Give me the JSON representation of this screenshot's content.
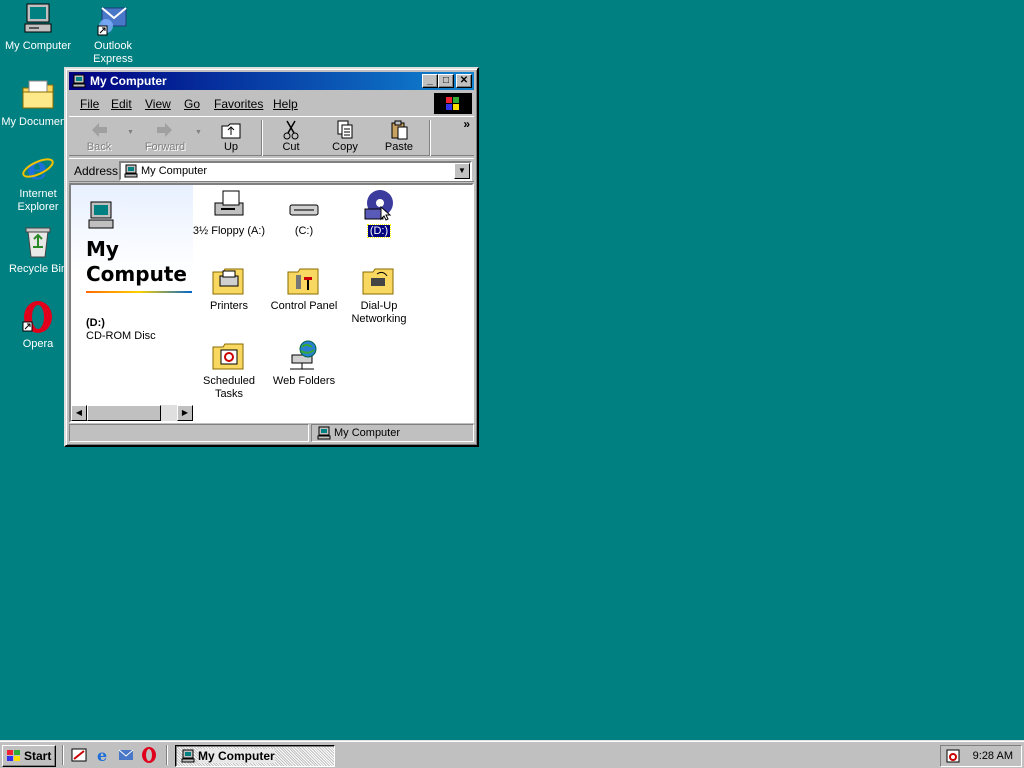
{
  "desktop": {
    "icons": [
      {
        "label": "My Computer"
      },
      {
        "label": "Outlook Express"
      },
      {
        "label": "My Documents"
      },
      {
        "label": "Internet Explorer"
      },
      {
        "label": "Recycle Bin"
      },
      {
        "label": "Opera"
      }
    ],
    "background_color": "#008080"
  },
  "window": {
    "title": "My Computer",
    "menu": [
      "File",
      "Edit",
      "View",
      "Go",
      "Favorites",
      "Help"
    ],
    "toolbar": {
      "back": "Back",
      "forward": "Forward",
      "up": "Up",
      "cut": "Cut",
      "copy": "Copy",
      "paste": "Paste",
      "more": "»"
    },
    "address": {
      "label": "Address",
      "value": "My Computer"
    },
    "sidebar": {
      "title_line1": "My",
      "title_line2": "Compute",
      "selected_name": "(D:)",
      "selected_type": "CD-ROM Disc"
    },
    "items": [
      {
        "label": "3½ Floppy (A:)",
        "icon": "floppy-drive-icon"
      },
      {
        "label": "(C:)",
        "icon": "hard-drive-icon"
      },
      {
        "label": "(D:)",
        "icon": "cd-rom-icon"
      },
      {
        "label": "Printers",
        "icon": "printers-folder-icon"
      },
      {
        "label": "Control Panel",
        "icon": "control-panel-icon"
      },
      {
        "label": "Dial-Up Networking",
        "icon": "dialup-networking-icon"
      },
      {
        "label": "Scheduled Tasks",
        "icon": "scheduled-tasks-icon"
      },
      {
        "label": "Web Folders",
        "icon": "web-folders-icon"
      }
    ],
    "status": {
      "right": "My Computer"
    }
  },
  "taskbar": {
    "start": "Start",
    "task": "My Computer",
    "clock": "9:28 AM"
  }
}
